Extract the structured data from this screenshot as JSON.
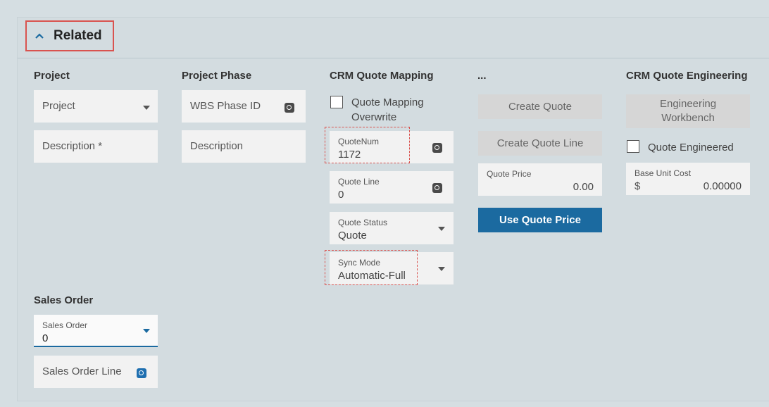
{
  "section": {
    "title": "Related"
  },
  "project": {
    "heading": "Project",
    "project_placeholder": "Project",
    "description_placeholder": "Description *"
  },
  "project_phase": {
    "heading": "Project Phase",
    "wbs_placeholder": "WBS Phase ID",
    "description_placeholder": "Description"
  },
  "crm_quote_mapping": {
    "heading": "CRM Quote Mapping",
    "overwrite_label_line1": "Quote Mapping",
    "overwrite_label_line2": "Overwrite",
    "overwrite_checked": false,
    "quote_num_label": "QuoteNum",
    "quote_num_value": "1172",
    "quote_line_label": "Quote Line",
    "quote_line_value": "0",
    "quote_status_label": "Quote Status",
    "quote_status_value": "Quote",
    "sync_mode_label": "Sync Mode",
    "sync_mode_value": "Automatic-Full"
  },
  "actions": {
    "heading": "...",
    "create_quote": "Create Quote",
    "create_quote_line": "Create Quote Line",
    "quote_price_label": "Quote Price",
    "quote_price_value": "0.00",
    "use_quote_price": "Use Quote Price"
  },
  "crm_quote_engineering": {
    "heading": "CRM Quote Engineering",
    "workbench_line1": "Engineering",
    "workbench_line2": "Workbench",
    "quote_engineered_label": "Quote Engineered",
    "quote_engineered_checked": false,
    "base_unit_cost_label": "Base Unit Cost",
    "currency": "$",
    "base_unit_cost_value": "0.00000"
  },
  "sales_order": {
    "heading": "Sales Order",
    "sales_order_label": "Sales Order",
    "sales_order_value": "0",
    "sales_order_line_placeholder": "Sales Order Line"
  },
  "colors": {
    "highlight": "#d9534f",
    "primary_button": "#1b6aa0",
    "lookup_blue": "#1f6fb0"
  }
}
